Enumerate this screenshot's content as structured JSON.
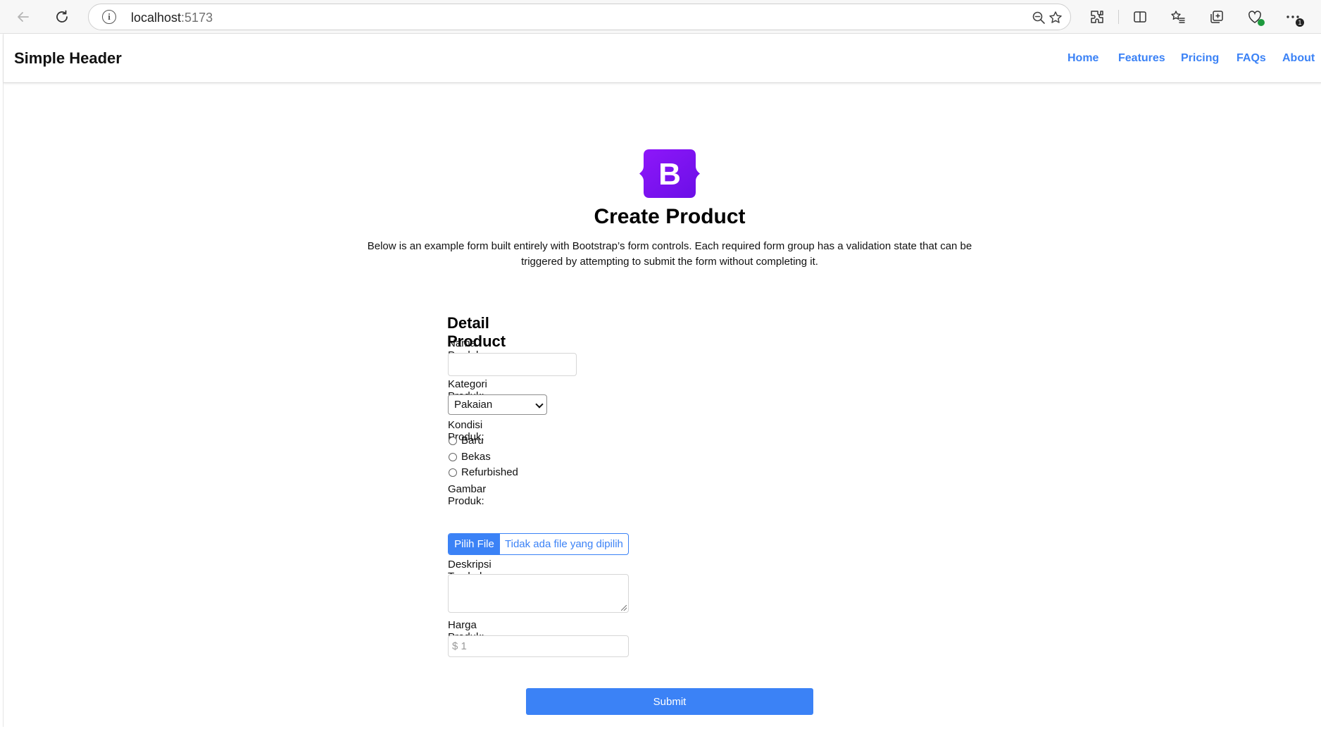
{
  "browser": {
    "url_host": "localhost",
    "url_port": ":5173",
    "notification_count": "1"
  },
  "header": {
    "brand": "Simple Header",
    "nav": [
      "Home",
      "Features",
      "Pricing",
      "FAQs",
      "About"
    ]
  },
  "hero": {
    "logo_letter": "B",
    "title": "Create Product",
    "description": "Below is an example form built entirely with Bootstrap’s form controls. Each required form group has a validation state that can be triggered by attempting to submit the form without completing it."
  },
  "form": {
    "section_title": "Detail Product",
    "name_label": "Nama Produk:",
    "name_value": "",
    "category_label": "Kategori Produk:",
    "category_selected": "Pakaian",
    "condition_label": "Kondisi Produk:",
    "condition_options": [
      "Baru",
      "Bekas",
      "Refurbished"
    ],
    "image_label": "Gambar Produk:",
    "file_button": "Pilih File",
    "file_status": "Tidak ada file yang dipilih",
    "description_label": "Deskripsi Tambahan:",
    "description_value": "",
    "price_label": "Harga Produk:",
    "price_placeholder": "$ 1",
    "submit_label": "Submit"
  },
  "colors": {
    "accent": "#3b82f6",
    "brand_purple": "#7c14f2"
  }
}
